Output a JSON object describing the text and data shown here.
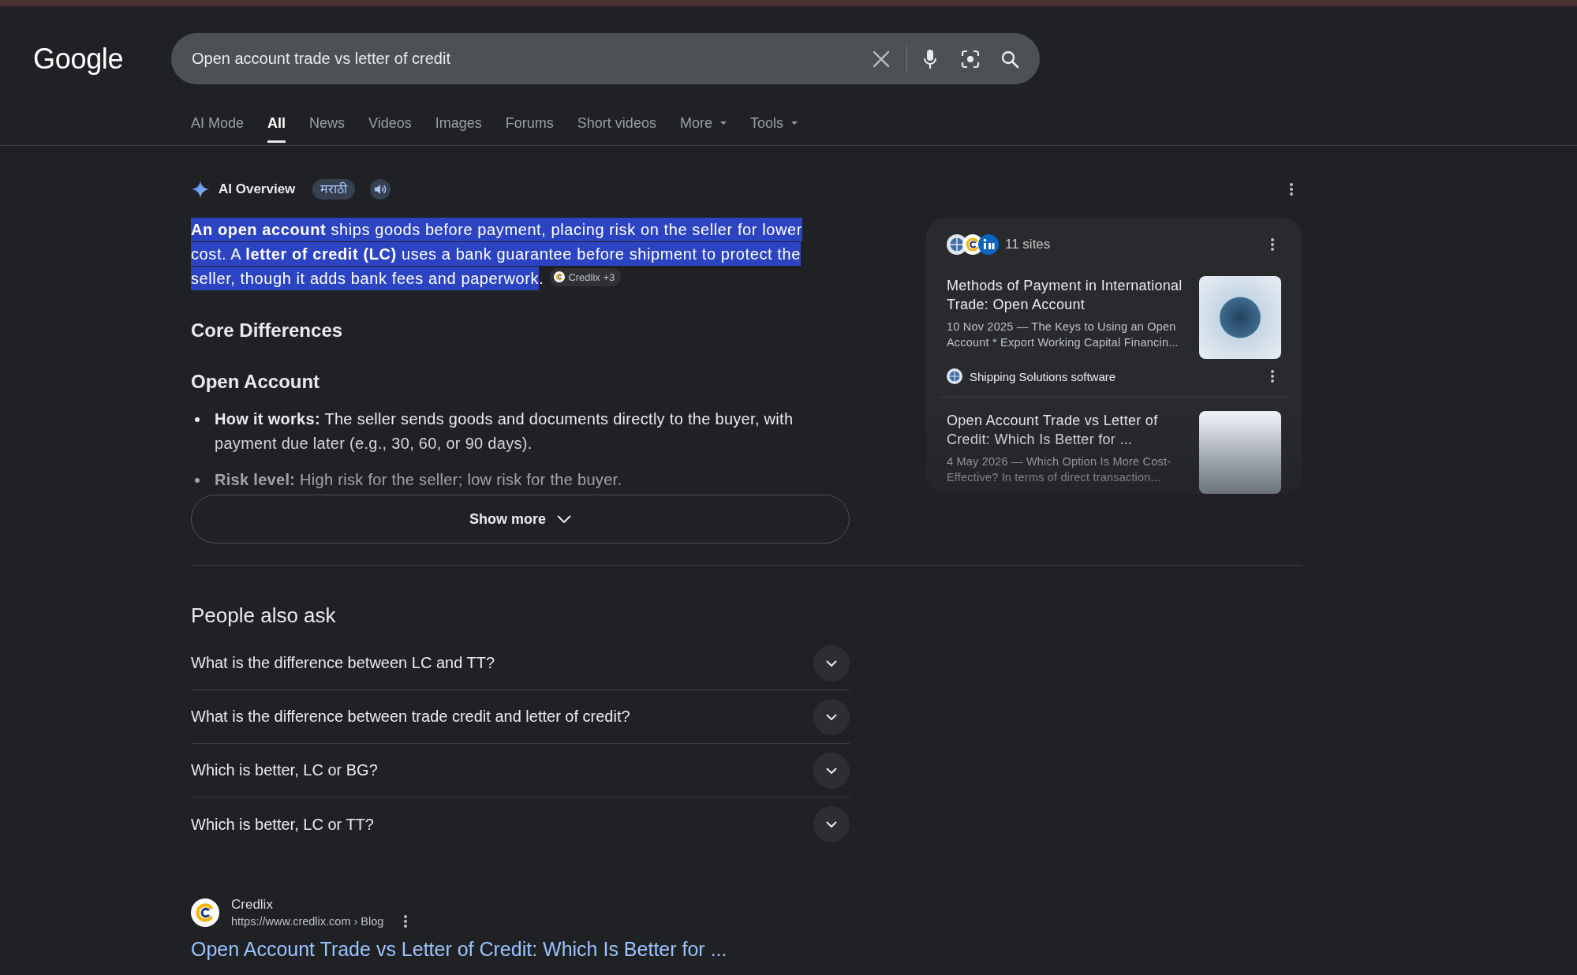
{
  "header": {
    "logo": "Google",
    "search": {
      "value": "Open account trade vs letter of credit"
    }
  },
  "tabs": [
    {
      "label": "AI Mode",
      "kind": "link",
      "selected": false
    },
    {
      "label": "All",
      "kind": "link",
      "selected": true
    },
    {
      "label": "News",
      "kind": "link",
      "selected": false
    },
    {
      "label": "Videos",
      "kind": "link",
      "selected": false
    },
    {
      "label": "Images",
      "kind": "link",
      "selected": false
    },
    {
      "label": "Forums",
      "kind": "link",
      "selected": false
    },
    {
      "label": "Short videos",
      "kind": "link",
      "selected": false
    },
    {
      "label": "More",
      "kind": "menu",
      "selected": false
    },
    {
      "label": "Tools",
      "kind": "menu",
      "selected": false
    }
  ],
  "ai_overview": {
    "title": "AI Overview",
    "language": "मराठी",
    "summary": {
      "text": "**An open account** ships goods before payment, placing risk on the seller for lower cost. A **letter of credit (LC)** uses a bank guarantee before shipment to protect the seller, though it adds bank fees and paperwork",
      "end": ".",
      "highlighted": true
    },
    "citation": "Credlix +3",
    "sections": [
      {
        "kind": "heading",
        "text": "Core Differences"
      },
      {
        "kind": "heading",
        "text": "Open Account"
      },
      {
        "kind": "bullets",
        "items": [
          "**How it works:** The seller sends goods and documents directly to the buyer, with payment due later (e.g., 30, 60, or 90 days).",
          "**Risk level:** High risk for the seller; low risk for the buyer."
        ]
      }
    ],
    "show_more": "Show more",
    "sources": {
      "count": "11 sites",
      "items": [
        {
          "title": "Methods of Payment in International Trade: Open Account",
          "snippet": "10 Nov 2025 — The Keys to Using an Open Account * Export Working Capital Financin...",
          "source": "Shipping Solutions software"
        },
        {
          "title": "Open Account Trade vs Letter of Credit: Which Is Better for ...",
          "snippet": "4 May 2026 — Which Option Is More Cost-Effective? In terms of direct transaction..."
        }
      ]
    }
  },
  "people_also_ask": {
    "title": "People also ask",
    "questions": [
      {
        "text": "What is the difference between LC and TT?",
        "expanded": false
      },
      {
        "text": "What is the difference between trade credit and letter of credit?",
        "expanded": false
      },
      {
        "text": "Which is better, LC or BG?",
        "expanded": false
      },
      {
        "text": "Which is better, LC or TT?",
        "expanded": false
      }
    ]
  },
  "results": [
    {
      "site": "Credlix",
      "url": "https://www.credlix.com › Blog",
      "title": "Open Account Trade vs Letter of Credit: Which Is Better for ..."
    }
  ]
}
